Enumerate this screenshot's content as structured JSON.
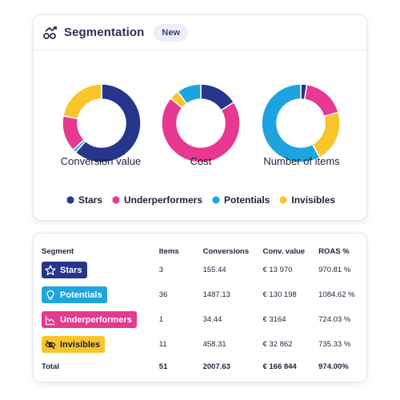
{
  "header": {
    "title": "Segmentation",
    "badge": "New"
  },
  "colors": {
    "Stars": "#27368a",
    "Underperformers": "#e6398f",
    "Potentials": "#1ea5df",
    "Invisibles": "#f8c52b"
  },
  "chart_data": [
    {
      "type": "pie",
      "title": "Conversion value",
      "categories": [
        "Stars",
        "Potentials",
        "Underperformers",
        "Invisibles"
      ],
      "values": [
        61.6,
        1.4,
        15.0,
        22.0
      ]
    },
    {
      "type": "pie",
      "title": "Cost",
      "categories": [
        "Stars",
        "Underperformers",
        "Invisibles",
        "Potentials"
      ],
      "values": [
        16.0,
        70.0,
        4.0,
        10.0
      ]
    },
    {
      "type": "pie",
      "title": "Number of items",
      "categories": [
        "Stars",
        "Underperformers",
        "Invisibles",
        "Potentials"
      ],
      "values": [
        2.5,
        18.0,
        21.5,
        58.0
      ]
    }
  ],
  "legend": [
    {
      "name": "Stars",
      "color": "#27368a"
    },
    {
      "name": "Underperformers",
      "color": "#e6398f"
    },
    {
      "name": "Potentials",
      "color": "#1ea5df"
    },
    {
      "name": "Invisibles",
      "color": "#f8c52b"
    }
  ],
  "table": {
    "headers": [
      "Segment",
      "Items",
      "Conversions",
      "Conv. value",
      "ROAS %"
    ],
    "rows": [
      {
        "segment": "Stars",
        "icon": "star-icon",
        "items": "3",
        "conversions": "155.44",
        "conv_value": "€ 13 970",
        "roas": "970.81 %"
      },
      {
        "segment": "Potentials",
        "icon": "lightbulb-icon",
        "items": "36",
        "conversions": "1487.13",
        "conv_value": "€ 130 198",
        "roas": "1084.62 %"
      },
      {
        "segment": "Underperformers",
        "icon": "trend-down-icon",
        "items": "1",
        "conversions": "34.44",
        "conv_value": "€ 3164",
        "roas": "724.03 %"
      },
      {
        "segment": "Invisibles",
        "icon": "eye-slash-icon",
        "items": "11",
        "conversions": "458.31",
        "conv_value": "€ 32 862",
        "roas": "735.33 %"
      }
    ],
    "total": {
      "label": "Total",
      "items": "51",
      "conversions": "2007.63",
      "conv_value": "€ 166 844",
      "roas": "974.00%"
    }
  }
}
